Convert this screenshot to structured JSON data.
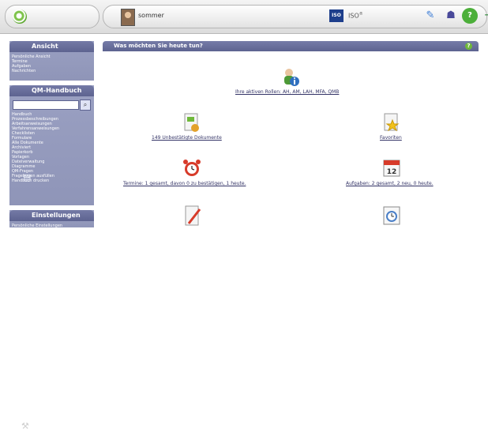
{
  "topbar": {
    "username": "sommer",
    "iso_label": "ISO",
    "iso_badge": "ISO",
    "tools": [
      "edit-icon",
      "users-icon",
      "help-icon",
      "logout-icon"
    ]
  },
  "sidebar": {
    "ansicht": {
      "title": "Ansicht",
      "items": [
        "Persönliche Ansicht",
        "Termine",
        "Aufgaben",
        "Nachrichten"
      ]
    },
    "qm_handbuch": {
      "title": "QM-Handbuch",
      "items": [
        "Handbuch",
        "Prozessbeschreibungen",
        "Arbeitsanweisungen",
        "Verfahrensanweisungen",
        "Checklisten",
        "Formulare",
        "Alle Dokumente",
        "Archiviert",
        "Papierkorb",
        "Vorlagen",
        "Dateiverwaltung",
        "Diagramme",
        "QM-Fragen",
        "Fragebogen ausfüllen",
        "Handbuch drucken"
      ]
    },
    "einstellungen": {
      "title": "Einstellungen",
      "items": [
        "Persönliche Einstellungen"
      ]
    }
  },
  "main": {
    "header": "Was möchten Sie heute tun?",
    "roles_link": "Ihre aktiven Rollen: AH, AM, LAH, MFA, QMB",
    "unconfirmed_link": "149 Unbestätigte Dokumente",
    "favorites_link": "Favoriten",
    "appointments_link": "Termine: 1 gesamt, davon 0 zu bestätigen, 1 heute.",
    "tasks_link": "Aufgaben: 2 gesamt, 2 neu, 0 heute."
  },
  "colors": {
    "panel": "#8f95b8",
    "panel_header": "#5d6390",
    "link": "#333366",
    "accent_green": "#6fb93a"
  }
}
